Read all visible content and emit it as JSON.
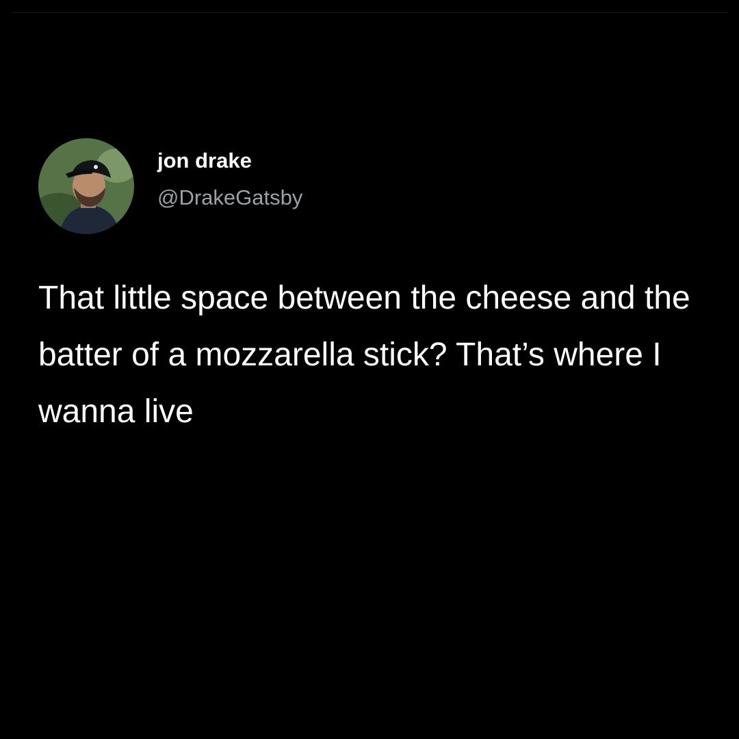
{
  "tweet": {
    "display_name": "jon drake",
    "handle": "@DrakeGatsby",
    "text": "That little space between the cheese and the batter of a mozzarella stick? That’s where I wanna live",
    "avatar": {
      "icon": "profile-photo-avatar",
      "background_color": "#5a7a48"
    }
  },
  "theme": {
    "background": "#000000",
    "text_color": "#ffffff",
    "handle_color": "#9ba1a6"
  }
}
